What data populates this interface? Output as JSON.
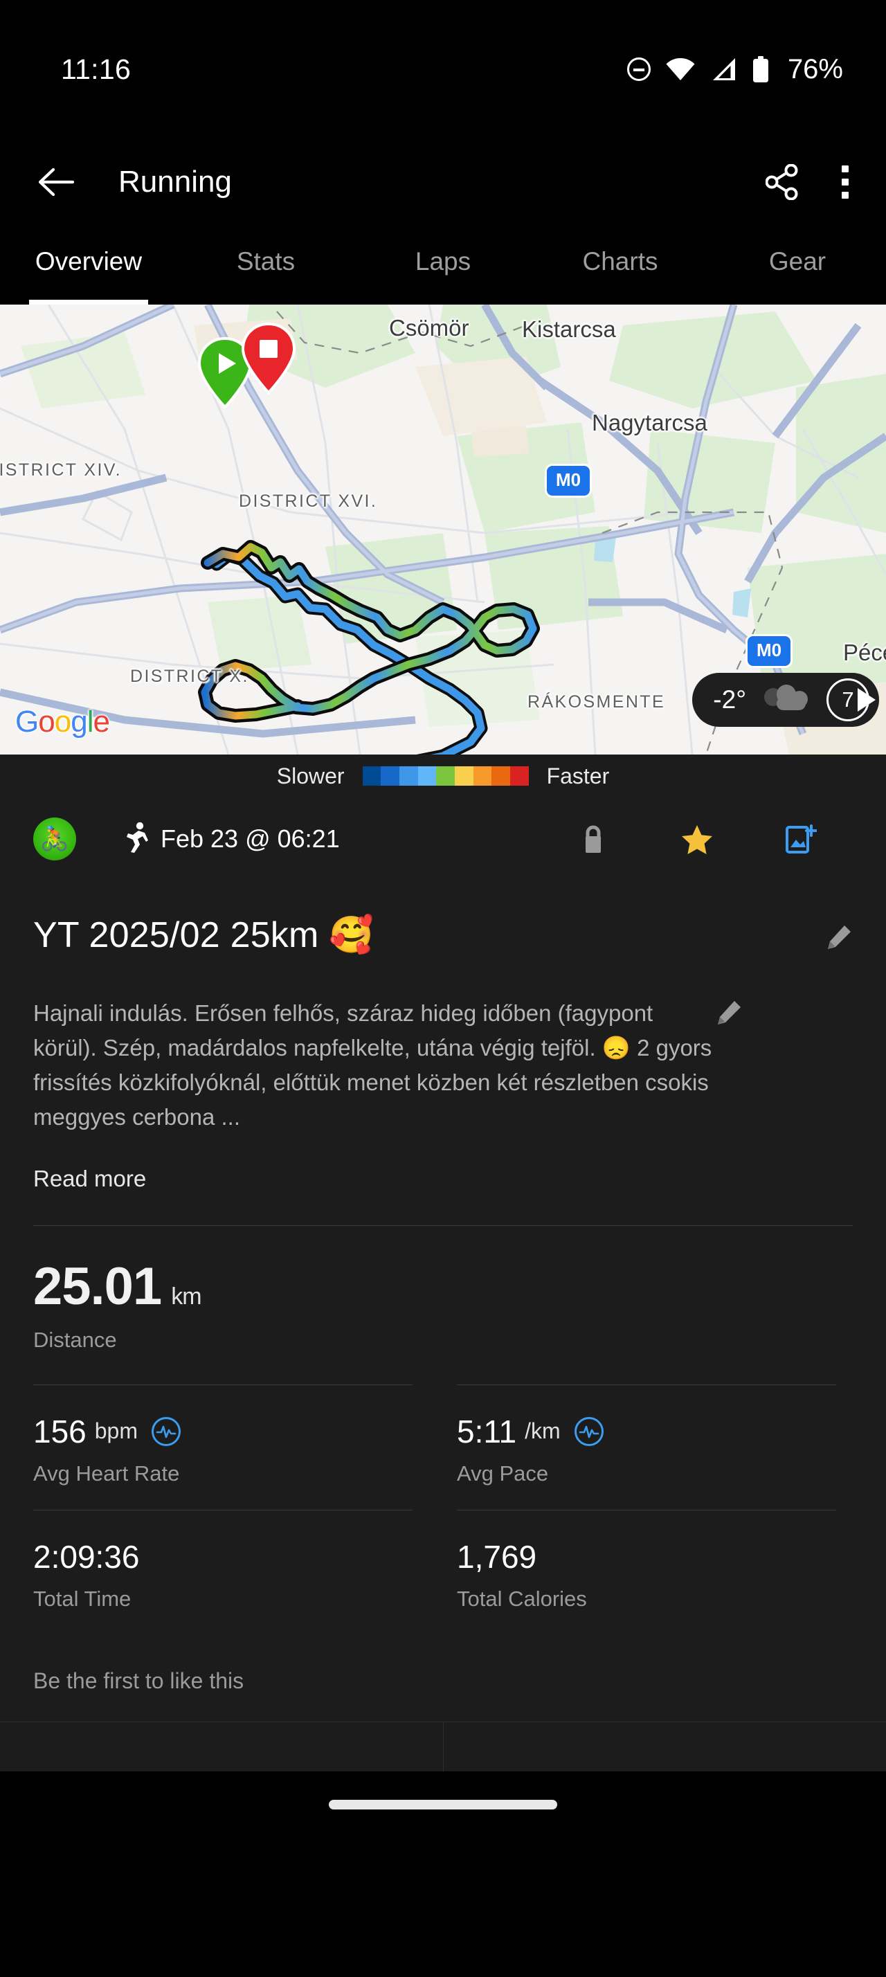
{
  "status_bar": {
    "time": "11:16",
    "battery_percent": "76%",
    "icons": [
      "dnd-icon",
      "wifi-icon",
      "cellular-signal-icon",
      "battery-icon"
    ]
  },
  "app_bar": {
    "back_icon": "back-arrow-icon",
    "title": "Running",
    "share_icon": "share-icon",
    "overflow_icon": "overflow-menu-icon"
  },
  "tabs": [
    {
      "label": "Overview",
      "active": true
    },
    {
      "label": "Stats",
      "active": false
    },
    {
      "label": "Laps",
      "active": false
    },
    {
      "label": "Charts",
      "active": false
    },
    {
      "label": "Gear",
      "active": false
    }
  ],
  "map": {
    "provider_logo": "Google",
    "labels": [
      {
        "text": "Csömör",
        "type": "town"
      },
      {
        "text": "Kistarcsa",
        "type": "town"
      },
      {
        "text": "Nagytarcsa",
        "type": "town"
      },
      {
        "text": "Pécel",
        "type": "town"
      },
      {
        "text": "DISTRICT XIV.",
        "type": "district"
      },
      {
        "text": "DISTRICT XVI.",
        "type": "district"
      },
      {
        "text": "DISTRICT X.",
        "type": "district"
      },
      {
        "text": "RÁKOSMENTE",
        "type": "district"
      }
    ],
    "highway_shields": [
      "M0",
      "M0"
    ],
    "start_marker": "start-pin-icon",
    "end_marker": "end-pin-icon",
    "weather": {
      "temperature": "-2°",
      "condition_icon": "cloudy-icon",
      "wind_speed": "7"
    }
  },
  "legend": {
    "slower_label": "Slower",
    "faster_label": "Faster",
    "colors": [
      "#004a94",
      "#1669c8",
      "#3f97e8",
      "#61b6f7",
      "#7cc63f",
      "#f9cf4e",
      "#f59a2b",
      "#e8690f",
      "#d92222"
    ]
  },
  "meta": {
    "avatar_icon": "user-avatar",
    "sport_icon": "running-icon",
    "date": "Feb 23 @ 06:21",
    "privacy_icon": "lock-icon",
    "favorite_icon": "star-icon",
    "add_photo_icon": "add-photo-icon"
  },
  "activity": {
    "title": "YT 2025/02 25km 🥰",
    "title_edit_icon": "edit-pencil-icon",
    "description": "Hajnali indulás. Erősen felhős, száraz hideg időben (fagypont körül). Szép, madárdalos napfelkelte, utána végig tejföl. 😞 2 gyors frissítés közkifolyóknál, előttük menet közben két részletben csokis meggyes cerbona ...",
    "description_edit_icon": "edit-pencil-icon",
    "read_more": "Read more"
  },
  "stats": {
    "hero": {
      "value": "25.01",
      "unit": "km",
      "label": "Distance"
    },
    "cells": [
      {
        "value": "156",
        "unit": "bpm",
        "label": "Avg Heart Rate",
        "badge": "heart-rate-icon"
      },
      {
        "value": "5:11",
        "unit": "/km",
        "label": "Avg Pace",
        "badge": "pace-icon"
      },
      {
        "value": "2:09:36",
        "unit": "",
        "label": "Total Time",
        "badge": ""
      },
      {
        "value": "1,769",
        "unit": "",
        "label": "Total Calories",
        "badge": ""
      }
    ]
  },
  "social": {
    "like_text": "Be the first to like this"
  },
  "colors": {
    "background": "#1c1c1c",
    "system_bar": "#000000",
    "accent_blue": "#3d9bf0",
    "star_gold": "#f5c13b",
    "start_green": "#3cb518",
    "end_red": "#e8252b"
  }
}
